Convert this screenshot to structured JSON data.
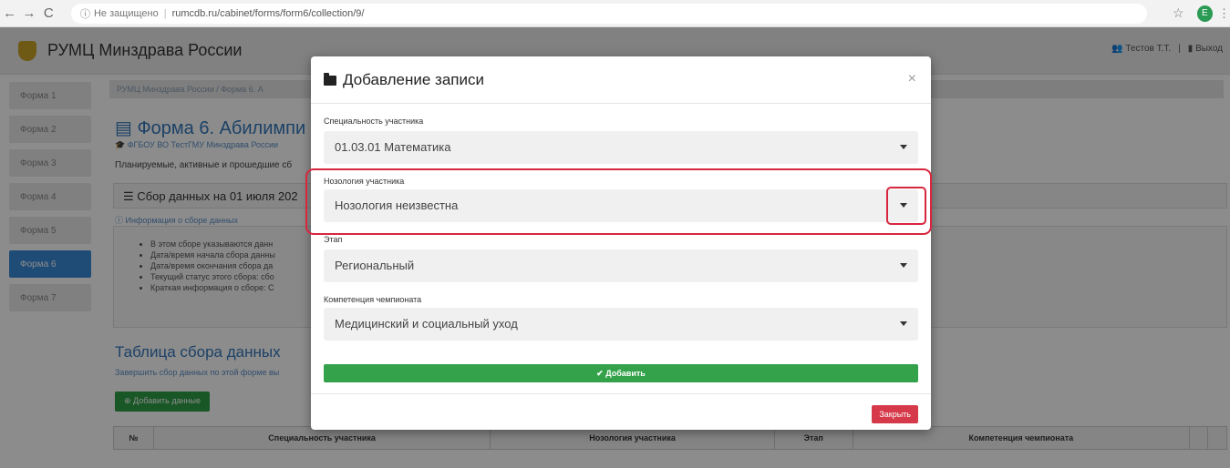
{
  "browser": {
    "security": "Не защищено",
    "url": "rumcdb.ru/cabinet/forms/form6/collection/9/",
    "profile_initial": "E"
  },
  "app": {
    "brand": "РУМЦ Минздрава России",
    "user": "Тестов Т.Т.",
    "logout": "Выход"
  },
  "sidebar": {
    "items": [
      {
        "label": "Форма 1"
      },
      {
        "label": "Форма 2"
      },
      {
        "label": "Форма 3"
      },
      {
        "label": "Форма 4"
      },
      {
        "label": "Форма 5"
      },
      {
        "label": "Форма 6"
      },
      {
        "label": "Форма 7"
      }
    ],
    "active_index": 5
  },
  "main": {
    "breadcrumb": "РУМЦ Минздрава России / Форма 6. А",
    "page_title": "Форма 6. Абилимпи",
    "org": "ФГБОУ ВО ТестГМУ Минздрава России",
    "planned_text": "Планируемые, активные и прошедшие сб",
    "collection_label": "Сбор данных на 01 июля 202",
    "info_link": "Информация о сборе данных",
    "info_items": [
      "В этом сборе указываются данн",
      "Дата/время начала сбора данны",
      "Дата/время окончания сбора да",
      "Текущий статус этого сбора: сбо",
      "Краткая информация о сборе: С"
    ],
    "table_title": "Таблица сбора данных",
    "table_sub": "Завершить сбор данных по этой форме вы",
    "add_data_label": "Добавить данные",
    "table_headers": [
      "№",
      "Специальность участника",
      "Нозология участника",
      "Этап",
      "Компетенция чемпионата"
    ]
  },
  "modal": {
    "title": "Добавление записи",
    "fields": [
      {
        "label": "Специальность участника",
        "value": "01.03.01 Математика"
      },
      {
        "label": "Нозология участника",
        "value": "Нозология неизвестна"
      },
      {
        "label": "Этап",
        "value": "Региональный"
      },
      {
        "label": "Компетенция чемпионата",
        "value": "Медицинский и социальный уход"
      }
    ],
    "add_label": "✔ Добавить",
    "close_label": "Закрыть"
  },
  "colors": {
    "accent": "#3377bb",
    "active_sidebar": "#3a8ad8",
    "success": "#33a24a",
    "danger": "#d63a4a",
    "highlight": "#d7263d"
  }
}
